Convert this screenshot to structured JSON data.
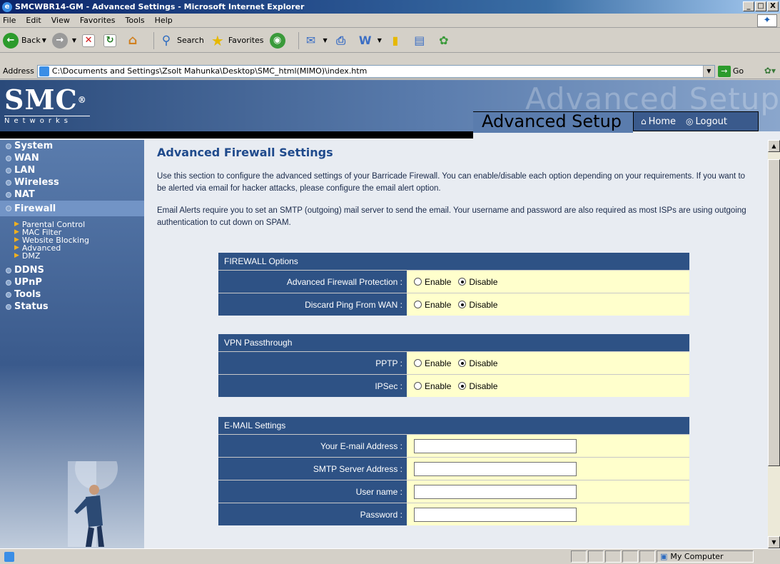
{
  "window": {
    "title": "SMCWBR14-GM - Advanced Settings - Microsoft Internet Explorer",
    "minimize": "_",
    "maximize": "□",
    "close": "X"
  },
  "menu": [
    "File",
    "Edit",
    "View",
    "Favorites",
    "Tools",
    "Help"
  ],
  "toolbar": {
    "back": "Back",
    "search": "Search",
    "favorites": "Favorites"
  },
  "address": {
    "label": "Address",
    "url": "C:\\Documents and Settings\\Zsolt Mahunka\\Desktop\\SMC_html(MIMO)\\index.htm",
    "go": "Go"
  },
  "banner": {
    "logo": "SMC",
    "logo_reg": "®",
    "logo_sub": "Networks",
    "ghost_title": "Advanced Setup",
    "title": "Advanced Setup",
    "home": "Home",
    "logout": "Logout"
  },
  "sidebar": {
    "items": [
      {
        "label": "System"
      },
      {
        "label": "WAN"
      },
      {
        "label": "LAN"
      },
      {
        "label": "Wireless"
      },
      {
        "label": "NAT"
      },
      {
        "label": "Firewall"
      }
    ],
    "sub_items": [
      "Parental Control",
      "MAC Filter",
      "Website Blocking",
      "Advanced",
      "DMZ"
    ],
    "items_after": [
      {
        "label": "DDNS"
      },
      {
        "label": "UPnP"
      },
      {
        "label": "Tools"
      },
      {
        "label": "Status"
      }
    ]
  },
  "main": {
    "heading": "Advanced Firewall Settings",
    "para1": "Use this section to configure the advanced settings of your Barricade Firewall. You can enable/disable each option depending on your requirements. If you want to be alerted via email for hacker attacks, please configure the email alert option.",
    "para2": "Email Alerts require you to set an SMTP (outgoing) mail server to send the email. Your username and password are also required as most ISPs are using outgoing authentication to cut down on SPAM.",
    "firewall": {
      "header": "FIREWALL Options",
      "rows": [
        {
          "label": "Advanced Firewall Protection :",
          "enable": "Enable",
          "disable": "Disable",
          "selected": "disable"
        },
        {
          "label": "Discard Ping From WAN :",
          "enable": "Enable",
          "disable": "Disable",
          "selected": "disable"
        }
      ]
    },
    "vpn": {
      "header": "VPN Passthrough",
      "rows": [
        {
          "label": "PPTP :",
          "enable": "Enable",
          "disable": "Disable",
          "selected": "disable"
        },
        {
          "label": "IPSec :",
          "enable": "Enable",
          "disable": "Disable",
          "selected": "disable"
        }
      ]
    },
    "email": {
      "header": "E-MAIL Settings",
      "rows": [
        {
          "label": "Your E-mail Address :",
          "value": ""
        },
        {
          "label": "SMTP Server Address :",
          "value": ""
        },
        {
          "label": "User name :",
          "value": ""
        },
        {
          "label": "Password :",
          "value": ""
        }
      ]
    }
  },
  "status": {
    "zone": "My Computer"
  },
  "colors": {
    "section_header": "#2e5285",
    "value_bg": "#ffffcc",
    "heading": "#1f4a8c"
  }
}
